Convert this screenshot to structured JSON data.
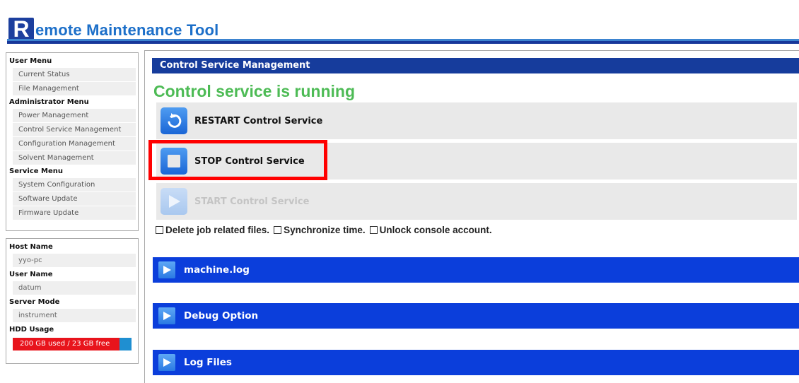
{
  "header": {
    "logo_letter": "R",
    "logo_rest": "emote Maintenance Tool"
  },
  "user_menu": {
    "heading": "User Menu",
    "items": [
      "Current Status",
      "File Management"
    ]
  },
  "admin_menu": {
    "heading": "Administrator Menu",
    "items": [
      "Power Management",
      "Control Service Management",
      "Configuration Management",
      "Solvent Management"
    ]
  },
  "service_menu": {
    "heading": "Service Menu",
    "items": [
      "System Configuration",
      "Software Update",
      "Firmware Update"
    ]
  },
  "info": {
    "host_name_label": "Host Name",
    "host_name": "yyo-pc",
    "user_name_label": "User Name",
    "user_name": "datum",
    "server_mode_label": "Server Mode",
    "server_mode": "instrument",
    "hdd_label": "HDD Usage",
    "hdd_text": "200 GB used / 23 GB free",
    "hdd_used_fraction": 0.897
  },
  "main": {
    "section_title": "Control Service Management",
    "status": "Control service is running",
    "restart_label": "RESTART Control Service",
    "stop_label": "STOP Control Service",
    "start_label": "START Control Service",
    "options": [
      "Delete job related files.",
      "Synchronize time.",
      "Unlock console account."
    ],
    "sections": [
      "machine.log",
      "Debug Option",
      "Log Files"
    ]
  },
  "colors": {
    "title_bar": "#163c9c",
    "status_green": "#4dbb55",
    "section_bar": "#0b3edb",
    "highlight": "#ff0000",
    "hdd_used": "#e8141c",
    "hdd_free": "#1f8fd1"
  },
  "icons": {
    "restart": "refresh-icon",
    "stop": "stop-icon",
    "start": "play-icon",
    "expand": "play-icon"
  }
}
